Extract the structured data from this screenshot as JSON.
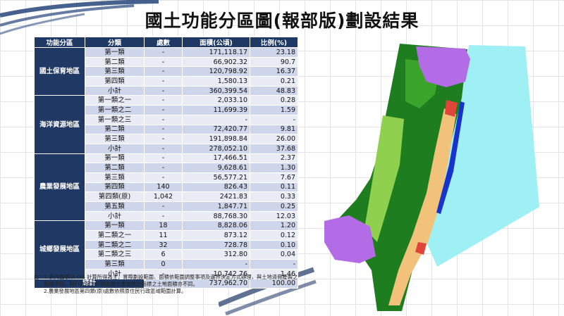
{
  "title": "國土功能分區圖(報部版)劃設結果",
  "table": {
    "headers": [
      "功能分區",
      "分類",
      "處數",
      "面積(公頃)",
      "比例(%)"
    ],
    "groups": [
      {
        "name": "國土保育地區",
        "rows": [
          [
            "第一類",
            "-",
            "171,118.17",
            "23.18"
          ],
          [
            "第二類",
            "-",
            "66,902.32",
            "90.7"
          ],
          [
            "第三類",
            "-",
            "120,798.92",
            "16.37"
          ],
          [
            "第四類",
            "-",
            "1,580.13",
            "0.21"
          ],
          [
            "小計",
            "-",
            "360,399.54",
            "48.83"
          ]
        ]
      },
      {
        "name": "海洋資源地區",
        "rows": [
          [
            "第一類之一",
            "-",
            "2,033.10",
            "0.28"
          ],
          [
            "第一類之二",
            "-",
            "11,699.39",
            "1.59"
          ],
          [
            "第一類之三",
            "-",
            "-",
            "-"
          ],
          [
            "第二類",
            "-",
            "72,420.77",
            "9.81"
          ],
          [
            "第三類",
            "-",
            "191,898.84",
            "26.00"
          ],
          [
            "小計",
            "-",
            "278,052.10",
            "37.68"
          ]
        ]
      },
      {
        "name": "農業發展地區",
        "rows": [
          [
            "第一類",
            "-",
            "17,466.51",
            "2.37"
          ],
          [
            "第二類",
            "-",
            "9,628.61",
            "1.30"
          ],
          [
            "第三類",
            "-",
            "56,577.21",
            "7.67"
          ],
          [
            "第四類",
            "140",
            "826.43",
            "0.11"
          ],
          [
            "第四類(原)",
            "1,042",
            "2421.83",
            "0.33"
          ],
          [
            "第五類",
            "-",
            "1,847.71",
            "0.25"
          ],
          [
            "小計",
            "-",
            "88,768.30",
            "12.03"
          ]
        ]
      },
      {
        "name": "城鄉發展地區",
        "rows": [
          [
            "第一類",
            "18",
            "8,828.06",
            "1.20"
          ],
          [
            "第二類之一",
            "11",
            "873.12",
            "0.12"
          ],
          [
            "第二類之二",
            "32",
            "728.78",
            "0.10"
          ],
          [
            "第二類之三",
            "6",
            "312.80",
            "0.04"
          ],
          [
            "第三類",
            "0",
            "-",
            "-"
          ],
          [
            "小計",
            "-",
            "10,742.76",
            "1.46"
          ]
        ]
      }
    ],
    "total": {
      "label": "總計",
      "count": "-",
      "area": "737,962.70",
      "ratio": "100.00"
    }
  },
  "notes": {
    "line1": "註：1.表內面積以 GIS 計算所得為主，實際劃設範圍、面積依範圍調整事項及邊界決定方式辦理，與土地清冊產製之面積不同，與行政院主計總處縣市重要統計指標之土地面積亦不同。",
    "line2": "2.農業發展地區第四類(原)處數依照原住民行政區域範圍計算。"
  },
  "map": {
    "colors": {
      "ocean": "#9ef0f5",
      "conservation_dark": "#1e7d1e",
      "conservation_mid": "#3aa52a",
      "conservation_light": "#8fd14f",
      "purple_zone": "#b36be6",
      "agriculture": "#f2c27a",
      "urban": "#e0453a",
      "blue_coast": "#1733c9"
    }
  }
}
